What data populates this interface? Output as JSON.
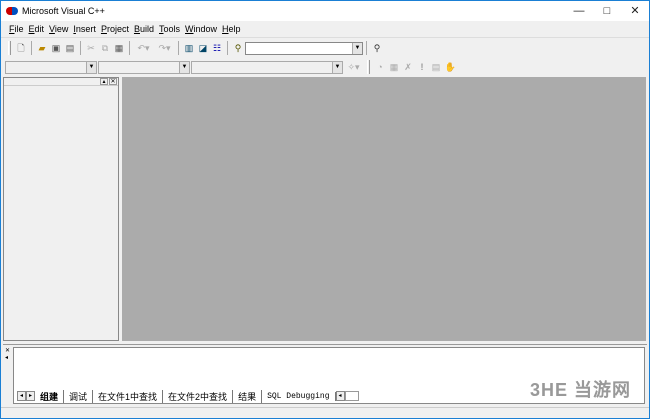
{
  "window": {
    "title": "Microsoft Visual C++",
    "min": "—",
    "max": "□",
    "close": "✕"
  },
  "menu": [
    "File",
    "Edit",
    "View",
    "Insert",
    "Project",
    "Build",
    "Tools",
    "Window",
    "Help"
  ],
  "toolbar": {
    "find_value": ""
  },
  "output": {
    "tabs": [
      "组建",
      "调试",
      "在文件1中查找",
      "在文件2中查找",
      "结果",
      "SQL Debugging"
    ],
    "active_tab": "组建"
  },
  "watermark": "3HE 当游网"
}
